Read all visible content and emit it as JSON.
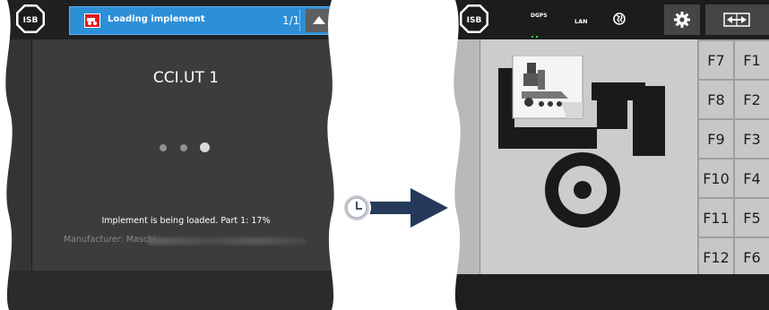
{
  "left_panel": {
    "isb_label": "ISB",
    "title_bar": {
      "title": "Loading implement",
      "pager": "1/1",
      "icon": "implement-icon",
      "collapse_icon": "chevron-up-icon"
    },
    "ut_title": "CCI.UT 1",
    "status": "Implement is being loaded. Part 1: 17%",
    "manufacturer_label": "Manufacturer: Maschi",
    "progress_percent": 17
  },
  "transition": {
    "icon": "clock-icon"
  },
  "right_panel": {
    "isb_label": "ISB",
    "status_items": {
      "dgps": "DGPS",
      "lan": "LAN",
      "globe_icon": "globe-icon"
    },
    "settings_icon": "gear-icon",
    "swap_icon": "swap-screens-icon",
    "fkeys_left": [
      "F7",
      "F8",
      "F9",
      "F10",
      "F11",
      "F12"
    ],
    "fkeys_right": [
      "F1",
      "F2",
      "F3",
      "F4",
      "F5",
      "F6"
    ]
  },
  "colors": {
    "title_blue": "#2d8fd6",
    "implement_red": "#e21a1a",
    "dgps_green": "#2fd14a"
  }
}
